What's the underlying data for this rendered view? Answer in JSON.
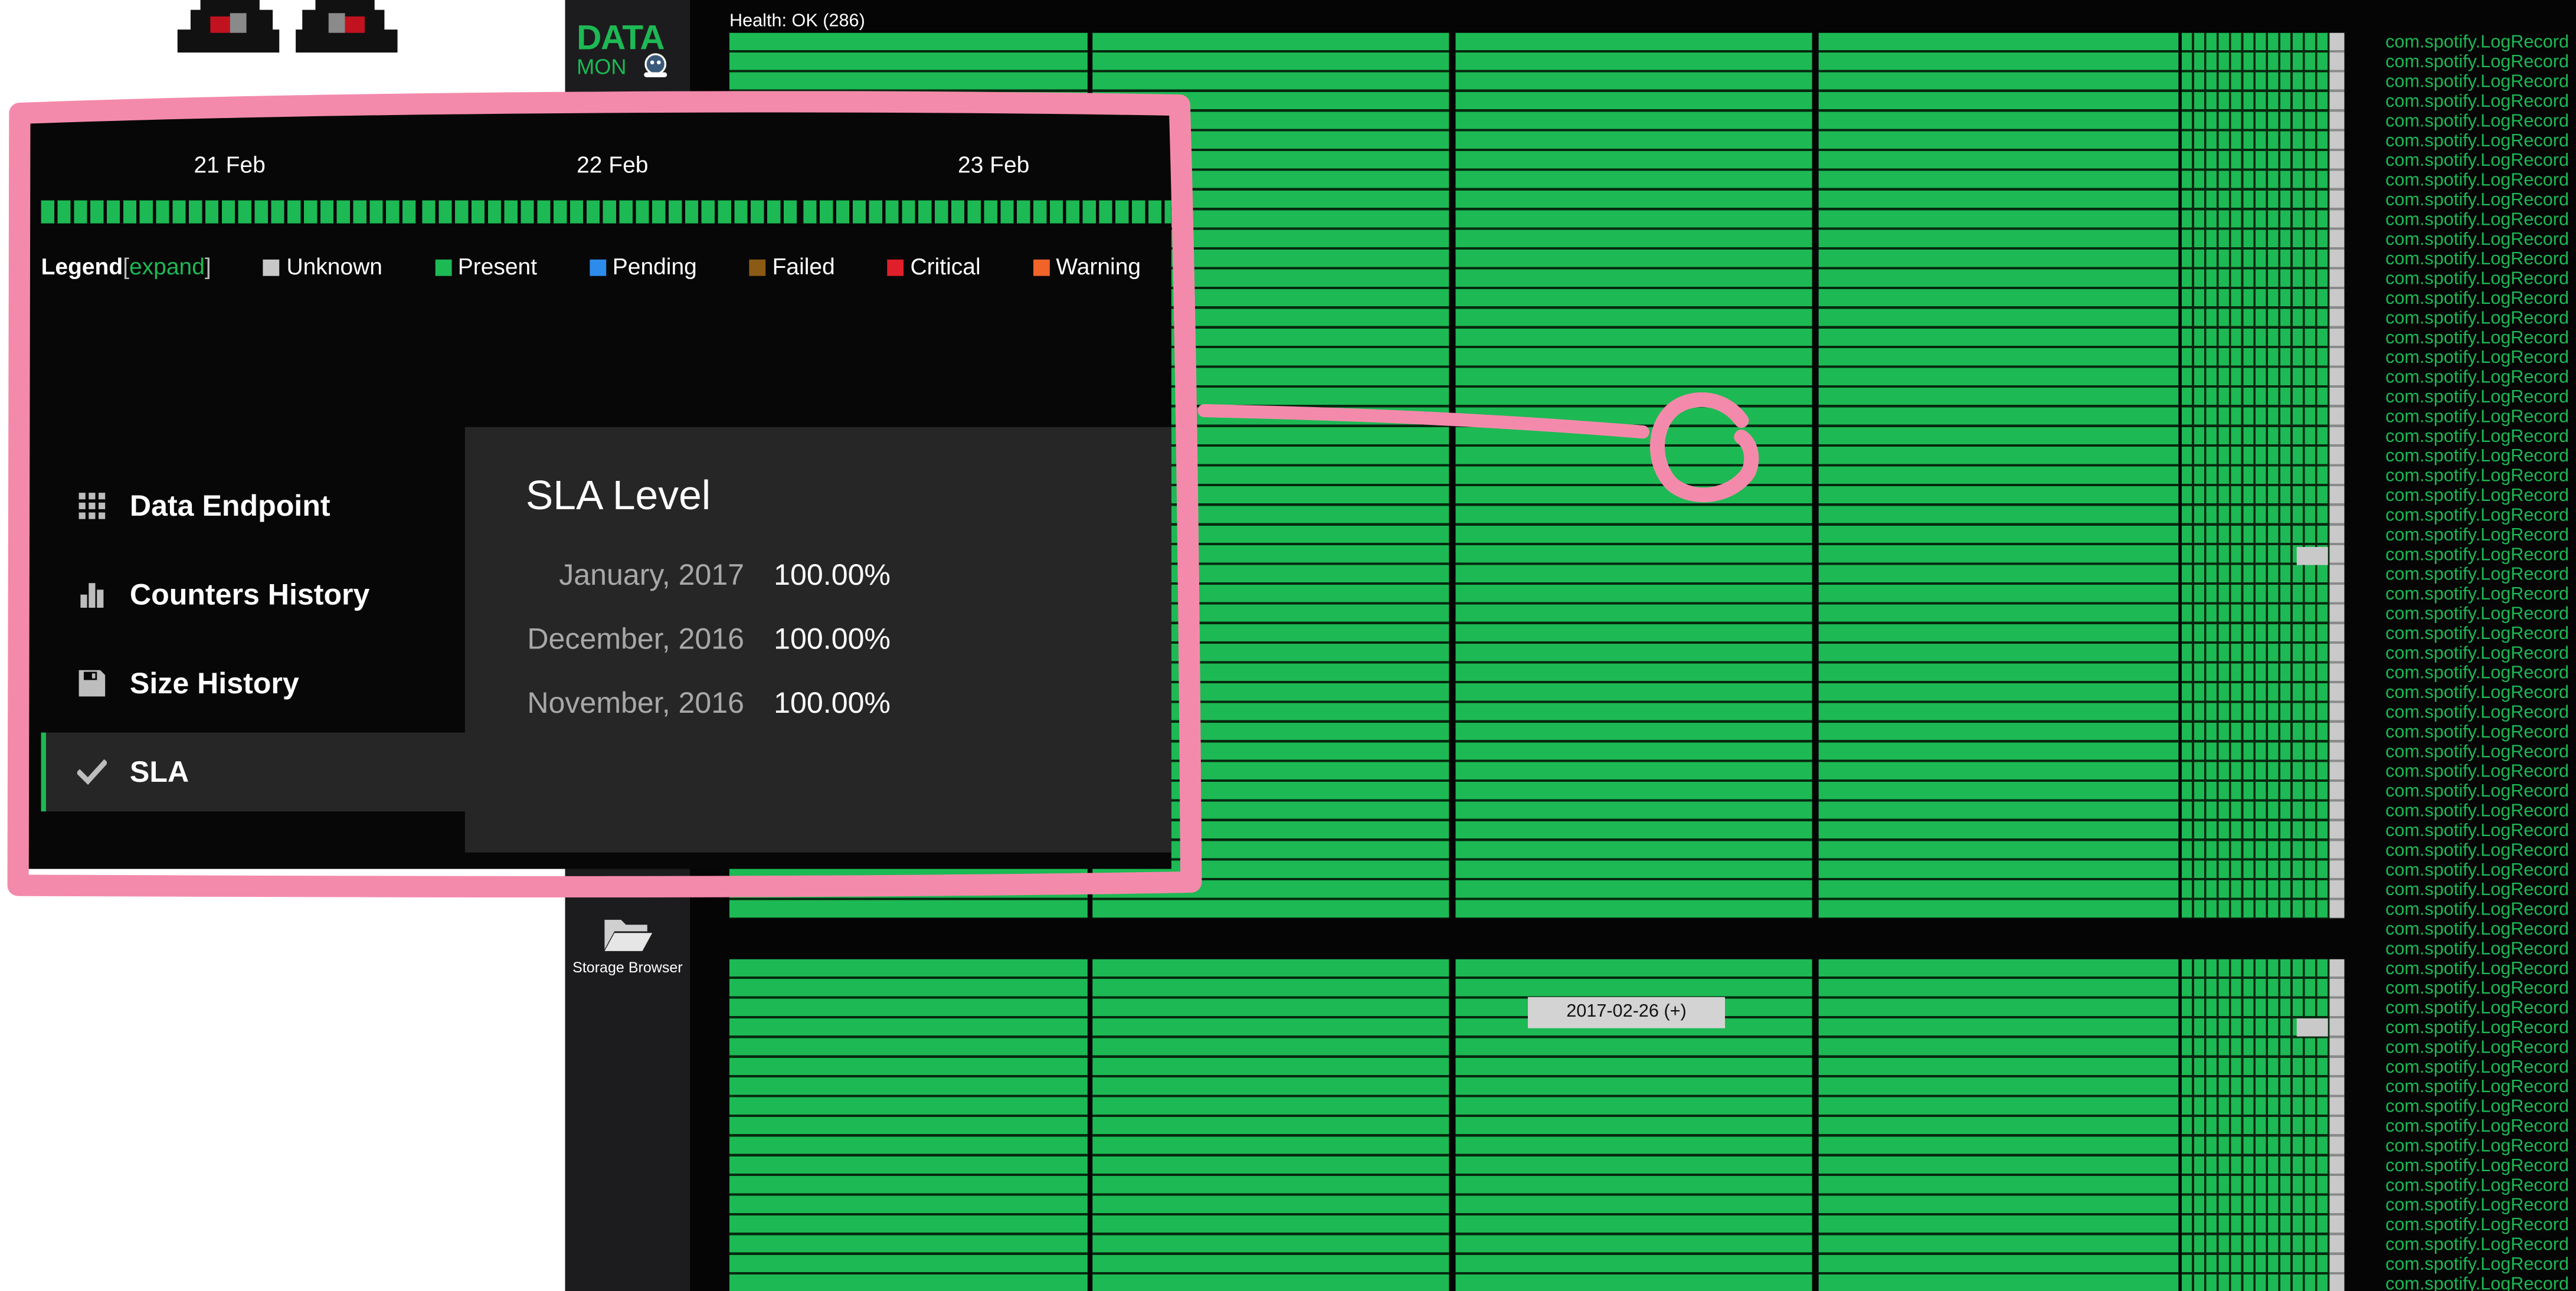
{
  "app": {
    "logo": {
      "line1": "DATA",
      "line2": "MON"
    },
    "health_status": "Health: OK (286)",
    "storage_browser_label": "Storage Browser",
    "date_tag": "2017-02-26 (+)",
    "row_label": "com.spotify.LogRecord",
    "row_label_count": 64,
    "colors": {
      "present": "#1db954",
      "background": "#050505",
      "sidebar": "#1c1c1e"
    }
  },
  "zoom": {
    "dates": [
      "21 Feb",
      "22 Feb",
      "23 Feb"
    ],
    "legend": {
      "title": "Legend",
      "expand": "expand",
      "items": [
        {
          "label": "Unknown",
          "color": "#c8c8c8"
        },
        {
          "label": "Present",
          "color": "#1db954"
        },
        {
          "label": "Pending",
          "color": "#2d8ceb"
        },
        {
          "label": "Failed",
          "color": "#8b5a14"
        },
        {
          "label": "Critical",
          "color": "#e01f2b"
        },
        {
          "label": "Warning",
          "color": "#f0642a"
        },
        {
          "label": "",
          "color": "#ffffff"
        }
      ]
    },
    "nav": [
      {
        "label": "Data Endpoint",
        "icon": "grid-icon",
        "active": false
      },
      {
        "label": "Counters History",
        "icon": "bar-chart-icon",
        "active": false
      },
      {
        "label": "Size History",
        "icon": "save-icon",
        "active": false
      },
      {
        "label": "SLA",
        "icon": "check-icon",
        "active": true
      }
    ],
    "sla": {
      "title": "SLA Level",
      "rows": [
        {
          "month": "January, 2017",
          "value": "100.00%"
        },
        {
          "month": "December, 2016",
          "value": "100.00%"
        },
        {
          "month": "November, 2016",
          "value": "100.00%"
        }
      ]
    }
  },
  "annotation": {
    "color": "#f48aab"
  }
}
